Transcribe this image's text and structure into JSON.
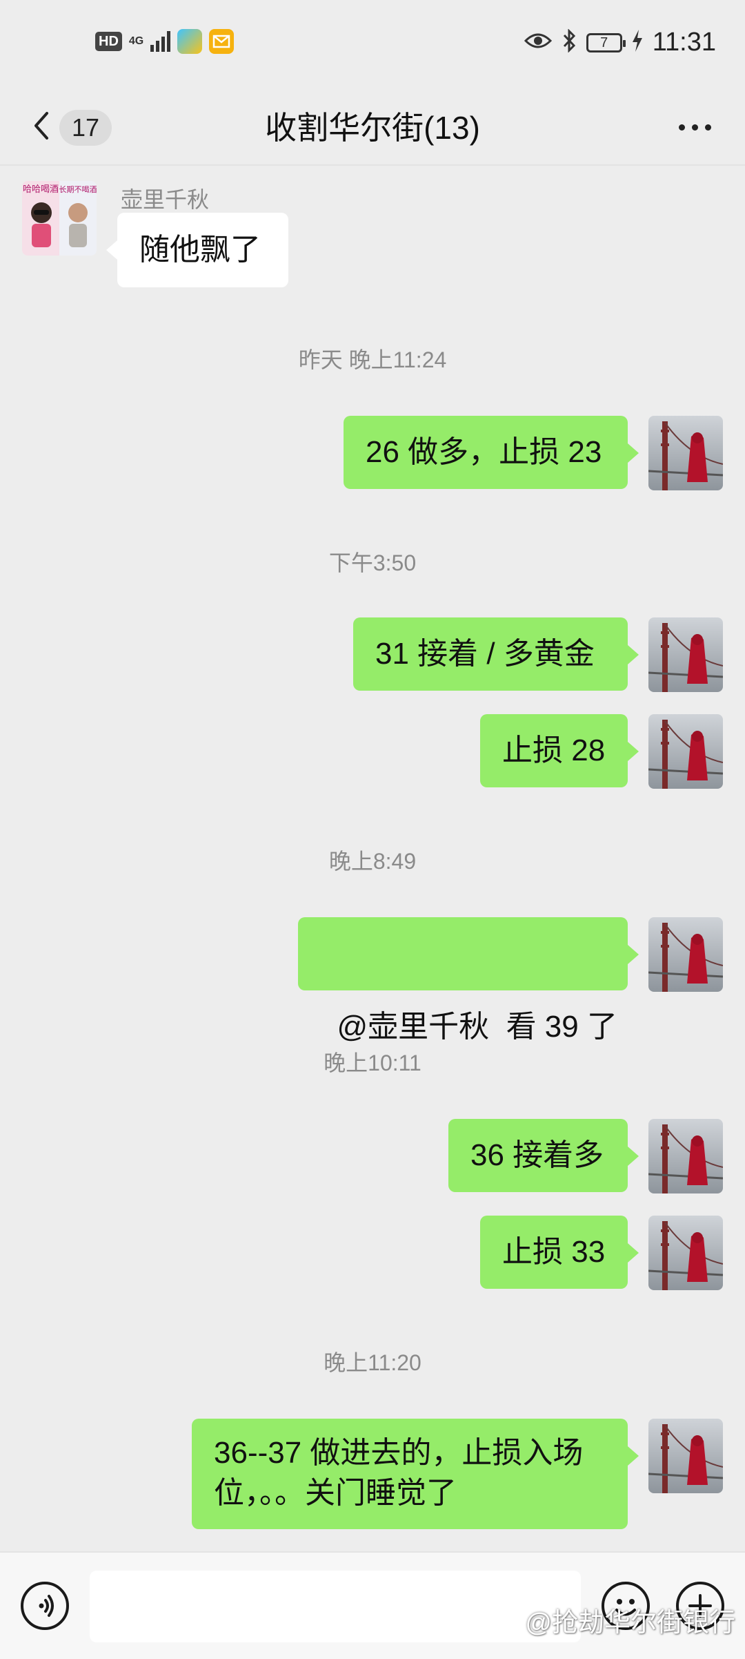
{
  "status_bar": {
    "hd": "HD",
    "network": "4G",
    "battery": "7",
    "time": "11:31",
    "icons": [
      "signal-icon",
      "app-store-icon",
      "mail-icon",
      "eye-icon",
      "bluetooth-icon",
      "battery-icon",
      "charging-icon"
    ]
  },
  "header": {
    "unread_count": "17",
    "title": "收割华尔街(13)"
  },
  "messages": [
    {
      "sender": "壶里千秋",
      "text": "随他飘了",
      "direction": "incoming"
    },
    {
      "text": "26 做多，止损 23",
      "direction": "outgoing"
    },
    {
      "text": "31 接着 / 多黄金",
      "direction": "outgoing"
    },
    {
      "text": "止损 28",
      "direction": "outgoing"
    },
    {
      "text": "@壶里千秋  看 39 了",
      "direction": "outgoing"
    },
    {
      "text": "36 接着多",
      "direction": "outgoing"
    },
    {
      "text": "止损 33",
      "direction": "outgoing"
    },
    {
      "line1": "36--37 做进去的，止损入场",
      "line2": "位，。。关门睡觉了",
      "direction": "outgoing"
    }
  ],
  "timestamps": [
    "昨天 晚上11:24",
    "下午3:50",
    "晚上8:49",
    "晚上10:11",
    "晚上11:20"
  ],
  "avatar_text": {
    "left": "哈哈喝酒",
    "right": "长期不喝酒"
  },
  "input": {
    "value": ""
  },
  "watermark": "@抢劫华尔街银行",
  "colors": {
    "background": "#ededed",
    "outgoing_bubble": "#95ec69",
    "incoming_bubble": "#ffffff",
    "timestamp": "#8a8a8a"
  }
}
